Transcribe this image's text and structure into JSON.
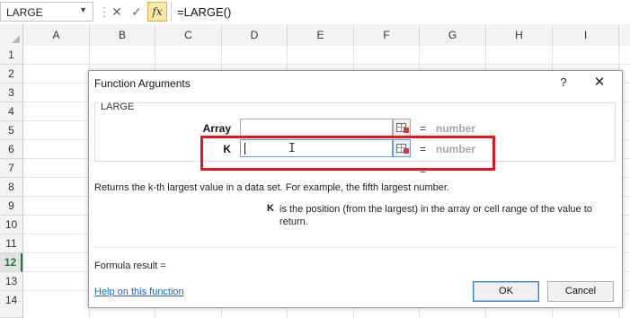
{
  "formula_bar": {
    "name_box": "LARGE",
    "name_box_arrow": "▼",
    "dots": "⋮",
    "cancel_icon": "✕",
    "enter_icon": "✓",
    "fx_label": "fx",
    "formula": "=LARGE()"
  },
  "columns": [
    "A",
    "B",
    "C",
    "D",
    "E",
    "F",
    "G",
    "H",
    "I"
  ],
  "rows": [
    "1",
    "2",
    "3",
    "4",
    "5",
    "6",
    "7",
    "8",
    "9",
    "10",
    "11",
    "12",
    "13",
    "14"
  ],
  "active_row": "12",
  "dialog": {
    "title": "Function Arguments",
    "help_label": "?",
    "close_label": "✕",
    "function_name": "LARGE",
    "args": [
      {
        "label": "Array",
        "value": "",
        "equals": "=",
        "result": "number"
      },
      {
        "label": "K",
        "value": "",
        "equals": "=",
        "result": "number"
      }
    ],
    "result_equals": "=",
    "description": "Returns the k-th largest value in a data set. For example, the fifth largest number.",
    "arg_desc_name": "K",
    "arg_desc_text": "is the position (from the largest) in the array or cell range of the value to return.",
    "formula_result_label": "Formula result =",
    "help_link": "Help on this function",
    "ok_label": "OK",
    "cancel_label": "Cancel"
  },
  "colors": {
    "highlight": "#e3161d",
    "link": "#2066b8",
    "active_row_accent": "#217346",
    "fx_button": "#fce8a6"
  }
}
